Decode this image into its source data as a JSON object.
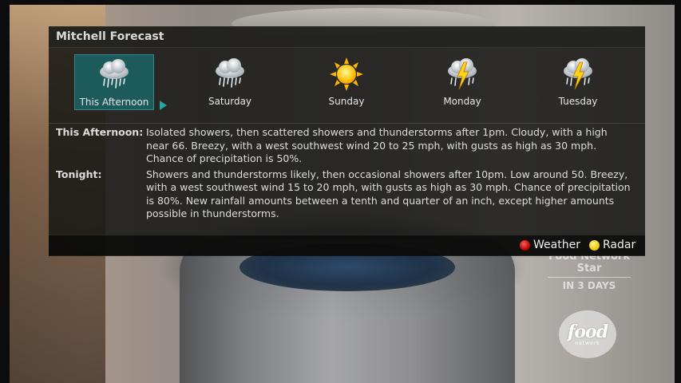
{
  "panel": {
    "title": "Mitchell Forecast",
    "days": [
      {
        "label": "This Afternoon",
        "icon": "rain-cloud-icon",
        "selected": true
      },
      {
        "label": "Saturday",
        "icon": "rain-cloud-icon"
      },
      {
        "label": "Sunday",
        "icon": "sun-icon"
      },
      {
        "label": "Monday",
        "icon": "thunderstorm-icon"
      },
      {
        "label": "Tuesday",
        "icon": "thunderstorm-icon"
      }
    ],
    "details": [
      {
        "label": "This Afternoon:",
        "text": "Isolated showers, then scattered showers and thunderstorms after 1pm.  Cloudy, with a high near 66. Breezy, with a west southwest wind 20 to 25 mph, with gusts as high as 30 mph.  Chance of precipitation is 50%."
      },
      {
        "label": "Tonight:",
        "text": "Showers and thunderstorms likely, then occasional showers after 10pm.  Low around 50. Breezy, with a west southwest wind 15 to 20 mph, with gusts as high as 30 mph.  Chance of precipitation is 80%. New rainfall amounts between a tenth and quarter of an inch, except higher amounts possible in thunderstorms."
      }
    ],
    "footer": {
      "red_action": "Weather",
      "yellow_action": "Radar"
    }
  },
  "promo": {
    "show": "Food Network Star",
    "when": "IN 3 DAYS",
    "logo_text": "food",
    "logo_subtext": "network"
  },
  "colors": {
    "selected_bg": "#1d5a5c",
    "red_button": "#d01010",
    "yellow_button": "#f2d800"
  }
}
